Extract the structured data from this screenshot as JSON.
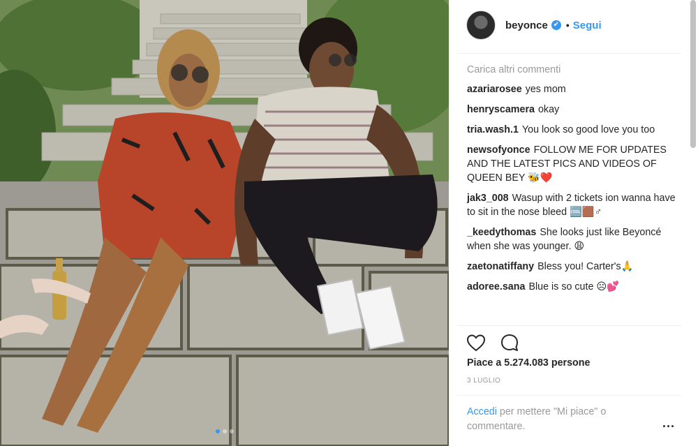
{
  "post": {
    "username": "beyonce",
    "verified_badge": "✔",
    "separator": "•",
    "follow_label": "Segui",
    "load_more_label": "Carica altri commenti",
    "comments": [
      {
        "user": "azariarosee",
        "text": "yes mom"
      },
      {
        "user": "henryscamera",
        "text": "okay"
      },
      {
        "user": "tria.wash.1",
        "text": "You look so good love you too"
      },
      {
        "user": "newsofyonce",
        "text": "FOLLOW ME FOR UPDATES AND THE LATEST PICS AND VIDEOS OF QUEEN BEY 🐝❤️"
      },
      {
        "user": "jak3_008",
        "text": "Wasup with 2 tickets ion wanna have to sit in the nose bleed 🆒🟫♂"
      },
      {
        "user": "_keedythomas",
        "text": "She looks just like Beyoncé when she was younger. 😩"
      },
      {
        "user": "zaetonatiffany",
        "text": "Bless you! Carter's🙏"
      },
      {
        "user": "adoree.sana",
        "text": "Blue is so cute ☹💕"
      }
    ],
    "likes_text": "Piace a 5.274.083 persone",
    "date_text": "3 LUGLIO",
    "login_link": "Accedi",
    "login_rest": " per mettere \"Mi piace\" o commentare.",
    "more_options": "...",
    "icons": {
      "like": "heart-outline-icon",
      "comment": "comment-bubble-icon"
    },
    "colors": {
      "link": "#3897f0",
      "muted": "#999999",
      "text": "#262626"
    }
  }
}
